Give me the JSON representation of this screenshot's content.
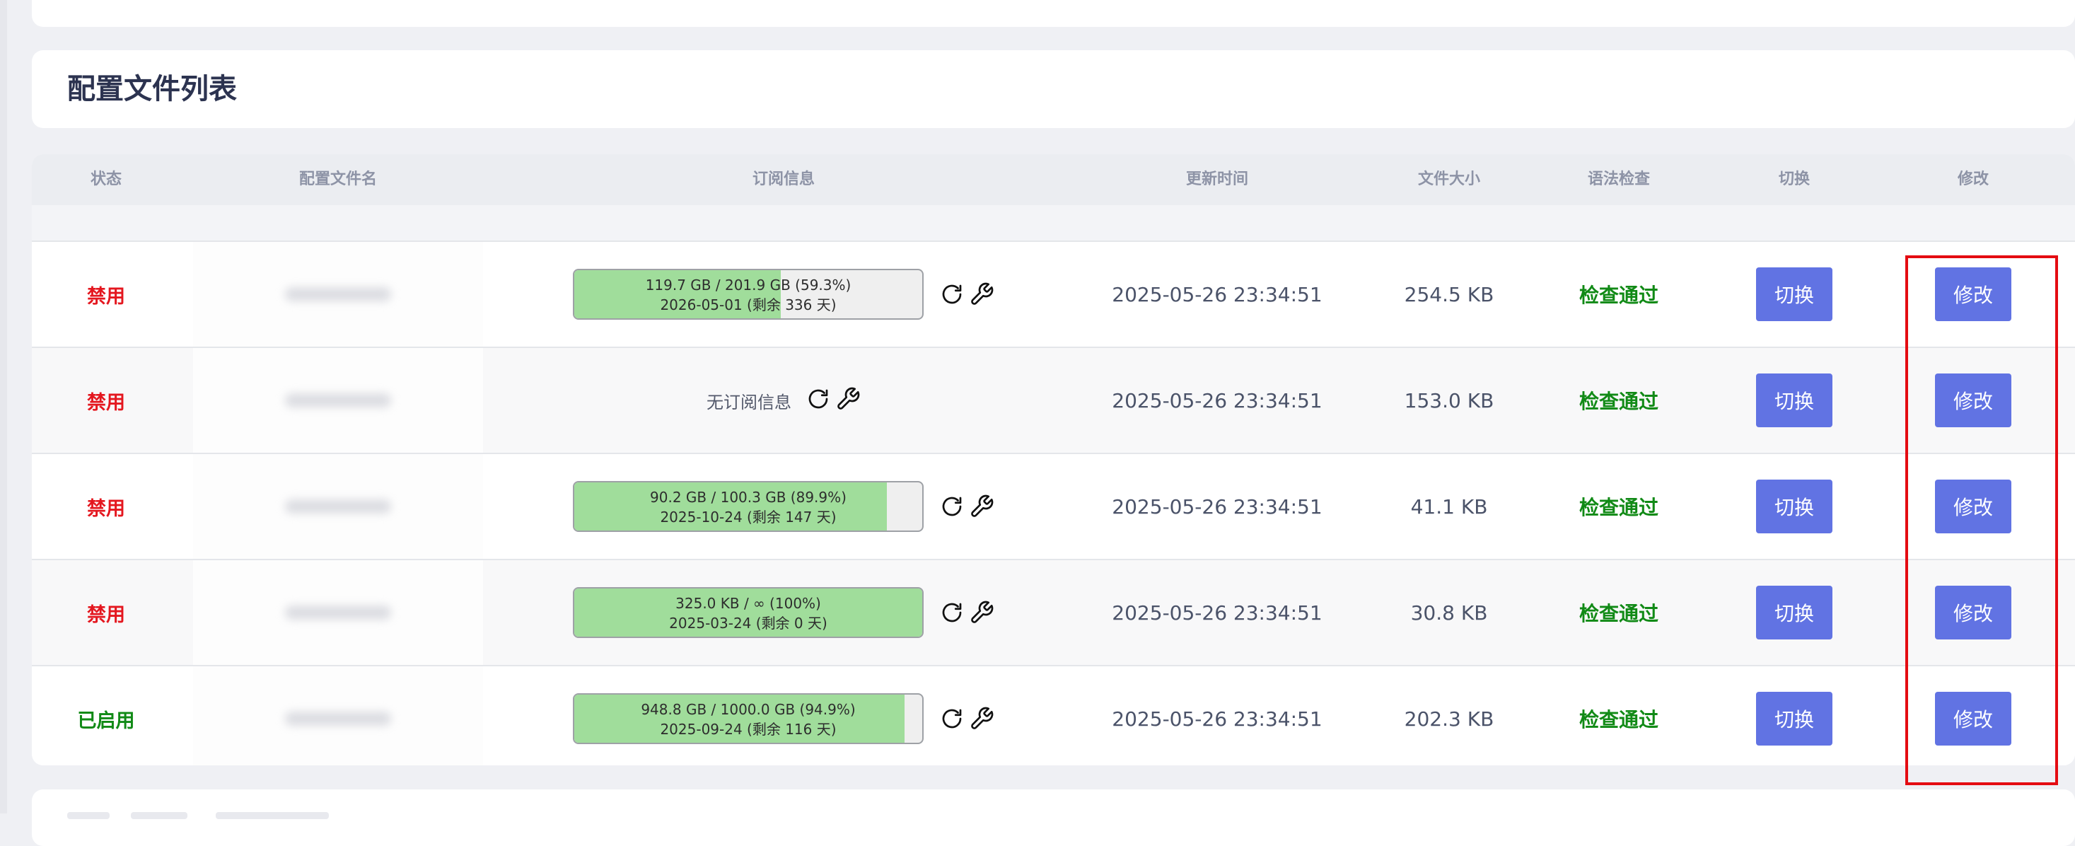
{
  "section": {
    "title": "配置文件列表"
  },
  "table": {
    "headers": {
      "status": "状态",
      "name": "配置文件名",
      "subscription": "订阅信息",
      "updated": "更新时间",
      "size": "文件大小",
      "syntax": "语法检查",
      "switch": "切换",
      "edit": "修改"
    },
    "rows": [
      {
        "status": "禁用",
        "status_color": "#e4171f",
        "has_subscription": true,
        "usage": "119.7 GB / 201.9 GB (59.3%)",
        "expiry": "2026-05-01 (剩余 336 天)",
        "percent": 59.3,
        "no_subscription_text": "",
        "updated": "2025-05-26 23:34:51",
        "size": "254.5 KB",
        "syntax": "检查通过",
        "switch_label": "切换",
        "edit_label": "修改"
      },
      {
        "status": "禁用",
        "status_color": "#e4171f",
        "has_subscription": false,
        "usage": "",
        "expiry": "",
        "percent": 0,
        "no_subscription_text": "无订阅信息",
        "updated": "2025-05-26 23:34:51",
        "size": "153.0 KB",
        "syntax": "检查通过",
        "switch_label": "切换",
        "edit_label": "修改"
      },
      {
        "status": "禁用",
        "status_color": "#e4171f",
        "has_subscription": true,
        "usage": "90.2 GB / 100.3 GB (89.9%)",
        "expiry": "2025-10-24 (剩余 147 天)",
        "percent": 89.9,
        "no_subscription_text": "",
        "updated": "2025-05-26 23:34:51",
        "size": "41.1 KB",
        "syntax": "检查通过",
        "switch_label": "切换",
        "edit_label": "修改"
      },
      {
        "status": "禁用",
        "status_color": "#e4171f",
        "has_subscription": true,
        "usage": "325.0 KB / ∞ (100%)",
        "expiry": "2025-03-24 (剩余 0 天)",
        "percent": 100,
        "no_subscription_text": "",
        "updated": "2025-05-26 23:34:51",
        "size": "30.8 KB",
        "syntax": "检查通过",
        "switch_label": "切换",
        "edit_label": "修改"
      },
      {
        "status": "已启用",
        "status_color": "#118a16",
        "has_subscription": true,
        "usage": "948.8 GB / 1000.0 GB (94.9%)",
        "expiry": "2025-09-24 (剩余 116 天)",
        "percent": 94.9,
        "no_subscription_text": "",
        "updated": "2025-05-26 23:34:51",
        "size": "202.3 KB",
        "syntax": "检查通过",
        "switch_label": "切换",
        "edit_label": "修改"
      }
    ]
  },
  "icons": {
    "refresh": "refresh-icon",
    "wrench": "wrench-icon"
  },
  "colors": {
    "accent_button": "#6173e3",
    "progress_fill": "#a0dd9b",
    "disabled_status": "#e4171f",
    "enabled_status": "#118a16",
    "highlight_box": "#e40c12"
  }
}
